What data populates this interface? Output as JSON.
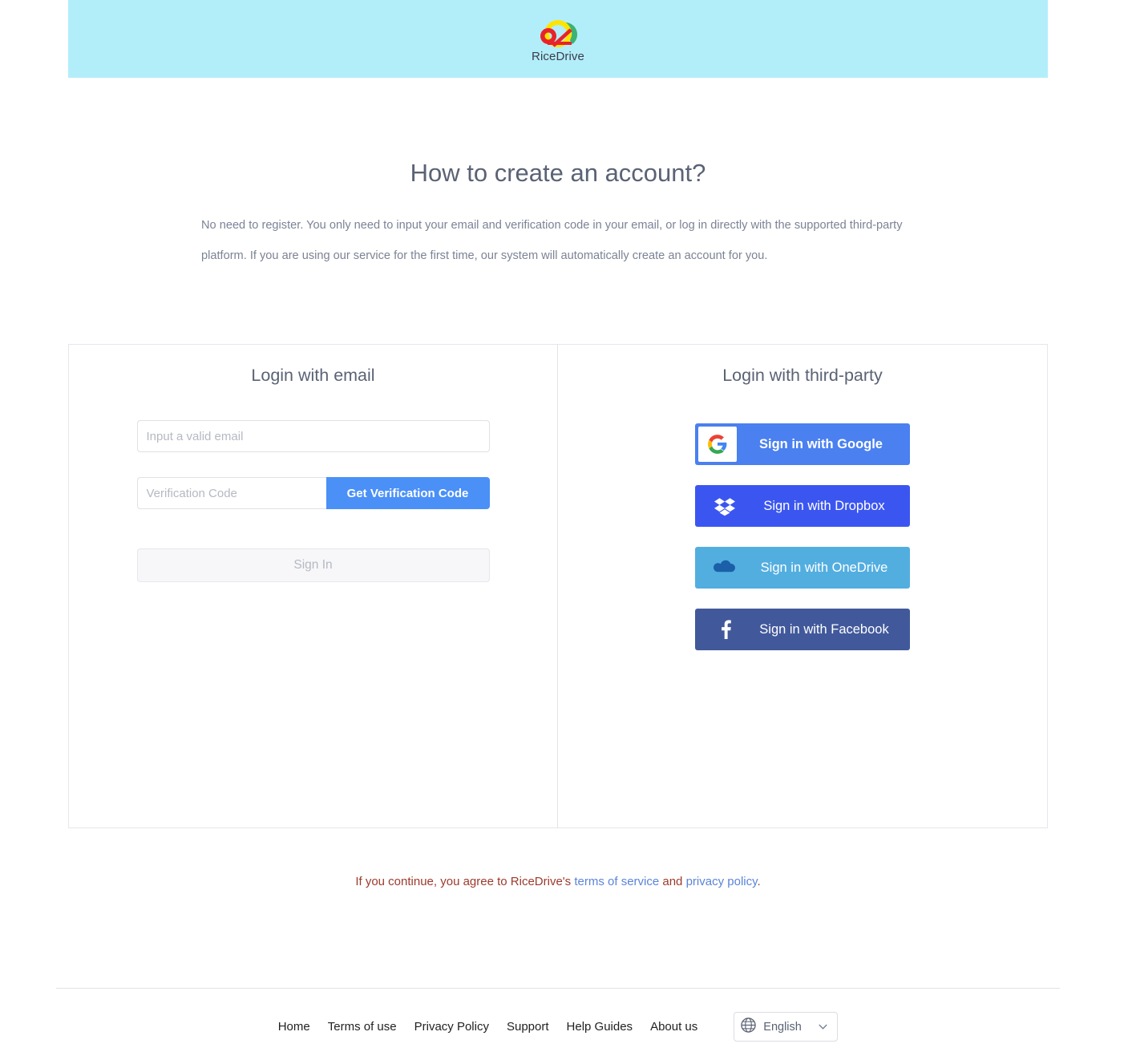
{
  "brand": {
    "name": "RiceDrive",
    "logo_icon": "ricedrive-cloud-logo",
    "header_bg": "#b2eefa"
  },
  "intro": {
    "title": "How to create an account?",
    "body": "No need to register. You only need to input your email and verification code in your email, or log in directly with the supported third-party platform. If you are using our service for the first time, our system will automatically create an account for you."
  },
  "email_login": {
    "heading": "Login with email",
    "email_placeholder": "Input a valid email",
    "email_value": "",
    "code_placeholder": "Verification Code",
    "code_value": "",
    "get_code_label": "Get Verification Code",
    "sign_in_label": "Sign In",
    "sign_in_disabled": true,
    "accent_color": "#4a90f7"
  },
  "third_party": {
    "heading": "Login with third-party",
    "providers": [
      {
        "label": "Sign in with Google",
        "icon": "google-icon",
        "color": "#4a80f0"
      },
      {
        "label": "Sign in with Dropbox",
        "icon": "dropbox-icon",
        "color": "#3b56f0"
      },
      {
        "label": "Sign in with OneDrive",
        "icon": "onedrive-icon",
        "color": "#53aee0"
      },
      {
        "label": "Sign in with Facebook",
        "icon": "facebook-icon",
        "color": "#41599b"
      }
    ]
  },
  "terms": {
    "prefix": "If you continue, you agree to RiceDrive's ",
    "terms_link": "terms of service",
    "middle": " and ",
    "privacy_link": "privacy policy",
    "suffix": ".",
    "text_color": "#9c3a2c",
    "link_color": "#5b84d8"
  },
  "footer": {
    "links": [
      {
        "label": "Home"
      },
      {
        "label": "Terms of use"
      },
      {
        "label": "Privacy Policy"
      },
      {
        "label": "Support"
      },
      {
        "label": "Help Guides"
      },
      {
        "label": "About us"
      }
    ],
    "language": {
      "selected": "English",
      "icon": "globe-icon",
      "chevron": "chevron-down-icon"
    }
  }
}
